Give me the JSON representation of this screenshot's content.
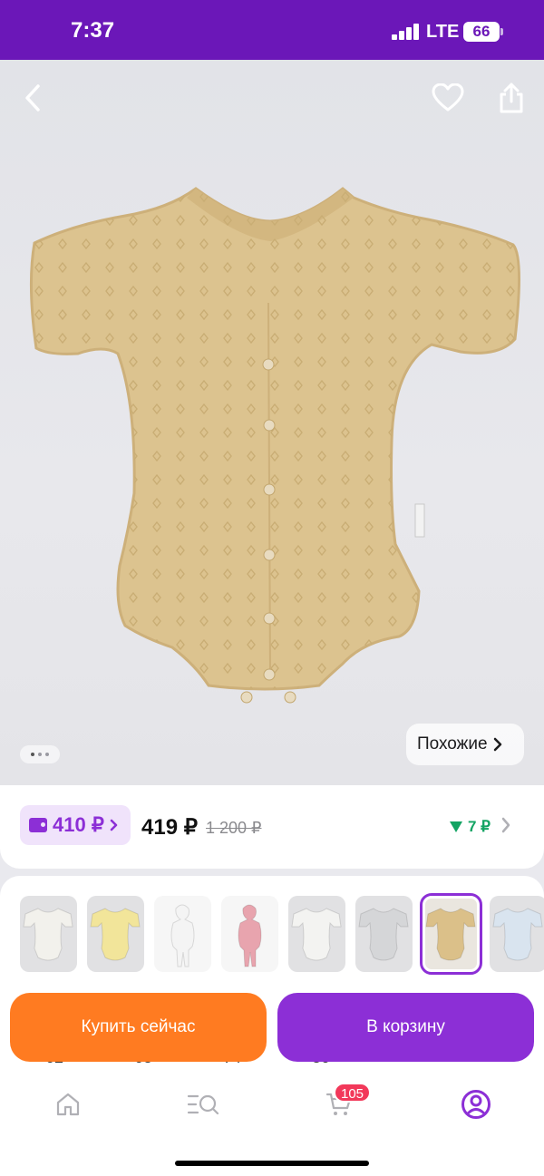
{
  "status_bar": {
    "time": "7:37",
    "network": "LTE",
    "battery": "66"
  },
  "product": {
    "similar_label": "Похожие",
    "gallery": {
      "count": 3,
      "active": 0
    }
  },
  "price": {
    "wallet_price": "410 ₽",
    "price": "419 ₽",
    "old_price": "1 200 ₽",
    "bonus": "7 ₽"
  },
  "variants": {
    "thumbs": [
      {
        "name": "white",
        "color": "#f2f1ec"
      },
      {
        "name": "yellow",
        "color": "#f2e59a"
      },
      {
        "name": "white-photo",
        "color": "#f4f4f4"
      },
      {
        "name": "pink-photo",
        "color": "#e8a4ae"
      },
      {
        "name": "white-2",
        "color": "#f3f3f1"
      },
      {
        "name": "grey",
        "color": "#d5d6d8"
      },
      {
        "name": "beige",
        "color": "#dbc089",
        "selected": true
      },
      {
        "name": "light-blue",
        "color": "#d9e4ef"
      }
    ],
    "sizes": [
      "62",
      "68",
      "74",
      "80"
    ]
  },
  "actions": {
    "buy_now": "Купить сейчас",
    "add_to_cart": "В корзину"
  },
  "tab_bar": {
    "cart_count": "105"
  },
  "colors": {
    "accent": "#8c2fd6",
    "buy": "#ff7b21",
    "status_bar": "#6b17b8",
    "bonus": "#13a463",
    "badge": "#f2385a"
  }
}
